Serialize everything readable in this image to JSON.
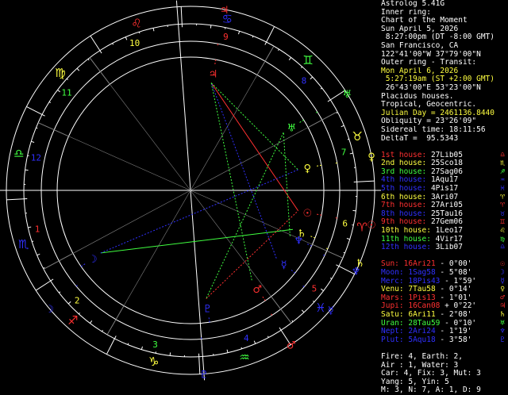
{
  "panel": {
    "title": "Astrolog 5.41G",
    "inner_ring_label": "Inner ring:",
    "inner_chart": "Chart of the Moment",
    "inner_date": "Sun April 5, 2026",
    "inner_time": " 8:27:00pm (DT -8:00 GMT)",
    "inner_place": "San Francisco, CA",
    "inner_coords": "122°41'00\"W 37°79'00\"N",
    "outer_ring_label": "Outer ring - Transit:",
    "outer_date": "Mon April 6, 2026",
    "outer_time": " 5:27:19am (ST +2:00 GMT)",
    "outer_coords": " 26°43'00\"E 53°23'00\"N",
    "houses_system": "Placidus houses.",
    "zodiac": "Tropical, Geocentric.",
    "julian_day": "Julian Day = 2461136.8440",
    "obliquity": "Obliquity = 23°26'09\"",
    "sidereal_time": "Sidereal time: 18:11:56",
    "delta_t": "DeltaT =  95.5343"
  },
  "houses": [
    {
      "label": "1st house:",
      "value": "27Lib05",
      "glyph": "♎",
      "color": "#ff3030"
    },
    {
      "label": "2nd house:",
      "value": "25Sco18",
      "glyph": "♏",
      "color": "#ffff40"
    },
    {
      "label": "3rd house:",
      "value": "27Sag06",
      "glyph": "♐",
      "color": "#40ff40"
    },
    {
      "label": "4th house:",
      "value": "1Aqu17",
      "glyph": "♒",
      "color": "#3030ff"
    },
    {
      "label": "5th house:",
      "value": "4Pis17",
      "glyph": "♓",
      "color": "#3030ff"
    },
    {
      "label": "6th house:",
      "value": "3Ari07",
      "glyph": "♈",
      "color": "#ffff40"
    },
    {
      "label": "7th house:",
      "value": "27Ari05",
      "glyph": "♈",
      "color": "#ff3030"
    },
    {
      "label": "8th house:",
      "value": "25Tau16",
      "glyph": "♉",
      "color": "#3030ff"
    },
    {
      "label": "9th house:",
      "value": "27Gem06",
      "glyph": "♊",
      "color": "#ff3030"
    },
    {
      "label": "10th house:",
      "value": "1Leo17",
      "glyph": "♌",
      "color": "#ffff40"
    },
    {
      "label": "11th house:",
      "value": "4Vir17",
      "glyph": "♍",
      "color": "#40ff40"
    },
    {
      "label": "12th house:",
      "value": "3Lib07",
      "glyph": "♎",
      "color": "#3030ff"
    }
  ],
  "planets": [
    {
      "label": "Sun:",
      "value": "16Ari21",
      "aspect": " - 0°00'",
      "glyph": "☉",
      "color": "#ff3030"
    },
    {
      "label": "Moon:",
      "value": "1Sag58",
      "aspect": " - 5°08'",
      "glyph": "☽",
      "color": "#3030ff"
    },
    {
      "label": "Merc:",
      "value": "18Pis43",
      "aspect": " - 1°59'",
      "glyph": "☿",
      "color": "#3030ff"
    },
    {
      "label": "Venu:",
      "value": "7Tau58",
      "aspect": " - 0°14'",
      "glyph": "♀",
      "color": "#ffff40"
    },
    {
      "label": "Mars:",
      "value": "1Pis13",
      "aspect": " - 1°01'",
      "glyph": "♂",
      "color": "#ff3030"
    },
    {
      "label": "Jupi:",
      "value": "16Can08",
      "aspect": " + 0°22'",
      "glyph": "♃",
      "color": "#ff3030"
    },
    {
      "label": "Satu:",
      "value": "6Ari11",
      "aspect": " - 2°08'",
      "glyph": "♄",
      "color": "#ffff40"
    },
    {
      "label": "Uran:",
      "value": "28Tau59",
      "aspect": " - 0°10'",
      "glyph": "♅",
      "color": "#40ff40"
    },
    {
      "label": "Nept:",
      "value": "2Ari24",
      "aspect": " - 1°19'",
      "glyph": "♆",
      "color": "#3030ff"
    },
    {
      "label": "Plut:",
      "value": "5Aqu18",
      "aspect": " - 3°58'",
      "glyph": "♇",
      "color": "#3030ff"
    }
  ],
  "summary": {
    "line1": "Fire: 4, Earth: 2,",
    "line2": "Air : 1, Water: 3",
    "line3": "Car: 4, Fix: 3, Mut: 3",
    "line4": "Yang: 5, Yin: 5",
    "line5": "M: 3, N: 7, A: 1, D: 9"
  },
  "colors": {
    "white": "#ffffff",
    "red": "#ff3030",
    "yellow": "#ffff40",
    "green": "#40ff40",
    "blue": "#3030ff",
    "gray": "#808080",
    "magenta": "#ff40ff"
  },
  "wheel": {
    "asc_longitude": 207.08,
    "cusps": [
      207.08,
      235.3,
      267.1,
      301.28,
      334.28,
      3.12,
      27.08,
      55.27,
      87.1,
      121.28,
      154.28,
      183.12
    ],
    "signs": [
      {
        "glyph": "♈",
        "color": "#ff3030"
      },
      {
        "glyph": "♉",
        "color": "#ffff40"
      },
      {
        "glyph": "♊",
        "color": "#40ff40"
      },
      {
        "glyph": "♋",
        "color": "#3030ff"
      },
      {
        "glyph": "♌",
        "color": "#ff3030"
      },
      {
        "glyph": "♍",
        "color": "#ffff40"
      },
      {
        "glyph": "♎",
        "color": "#40ff40"
      },
      {
        "glyph": "♏",
        "color": "#3030ff"
      },
      {
        "glyph": "♐",
        "color": "#ff3030"
      },
      {
        "glyph": "♑",
        "color": "#ffff40"
      },
      {
        "glyph": "♒",
        "color": "#40ff40"
      },
      {
        "glyph": "♓",
        "color": "#3030ff"
      }
    ],
    "house_numbers": [
      {
        "n": "1",
        "color": "#ff3030"
      },
      {
        "n": "2",
        "color": "#ffff40"
      },
      {
        "n": "3",
        "color": "#40ff40"
      },
      {
        "n": "4",
        "color": "#3030ff"
      },
      {
        "n": "5",
        "color": "#ff3030"
      },
      {
        "n": "6",
        "color": "#ffff40"
      },
      {
        "n": "7",
        "color": "#40ff40"
      },
      {
        "n": "8",
        "color": "#3030ff"
      },
      {
        "n": "9",
        "color": "#ff3030"
      },
      {
        "n": "10",
        "color": "#ffff40"
      },
      {
        "n": "11",
        "color": "#40ff40"
      },
      {
        "n": "12",
        "color": "#3030ff"
      }
    ],
    "inner_planets": [
      {
        "name": "sun",
        "glyph": "☉",
        "lon": 16.35,
        "color": "#ff3030"
      },
      {
        "name": "moon",
        "glyph": "☽",
        "lon": 241.97,
        "color": "#3030ff"
      },
      {
        "name": "mercury",
        "glyph": "☿",
        "lon": 348.72,
        "color": "#3030ff"
      },
      {
        "name": "venus",
        "glyph": "♀",
        "lon": 37.97,
        "color": "#ffff40"
      },
      {
        "name": "mars",
        "glyph": "♂",
        "lon": 331.22,
        "color": "#ff3030"
      },
      {
        "name": "jupiter",
        "glyph": "♃",
        "lon": 106.13,
        "color": "#ff3030"
      },
      {
        "name": "saturn",
        "glyph": "♄",
        "lon": 6.18,
        "color": "#ffff40"
      },
      {
        "name": "uranus",
        "glyph": "♅",
        "lon": 58.98,
        "color": "#40ff40"
      },
      {
        "name": "neptune",
        "glyph": "♆",
        "lon": 2.4,
        "color": "#3030ff"
      },
      {
        "name": "pluto",
        "glyph": "♇",
        "lon": 305.3,
        "color": "#3030ff"
      }
    ],
    "outer_planets": [
      {
        "name": "sun",
        "glyph": "☉",
        "lon": 16.35,
        "color": "#ff3030"
      },
      {
        "name": "moon",
        "glyph": "☽",
        "lon": 247.1,
        "color": "#3030ff"
      },
      {
        "name": "mercury",
        "glyph": "☿",
        "lon": 346.7,
        "color": "#3030ff"
      },
      {
        "name": "venus",
        "glyph": "♀",
        "lon": 37.7,
        "color": "#ffff40"
      },
      {
        "name": "mars",
        "glyph": "♂",
        "lon": 330.2,
        "color": "#ff3030"
      },
      {
        "name": "jupiter",
        "glyph": "♃",
        "lon": 106.5,
        "color": "#ff3030"
      },
      {
        "name": "saturn",
        "glyph": "♄",
        "lon": 4.0,
        "color": "#ffff40"
      },
      {
        "name": "uranus",
        "glyph": "♅",
        "lon": 58.8,
        "color": "#40ff40"
      },
      {
        "name": "neptune",
        "glyph": "♆",
        "lon": 1.1,
        "color": "#3030ff"
      },
      {
        "name": "pluto",
        "glyph": "♇",
        "lon": 301.3,
        "color": "#3030ff"
      }
    ],
    "aspects": [
      {
        "a": "sun",
        "b": "jupiter",
        "color": "#ff3030",
        "dash": "0"
      },
      {
        "a": "moon",
        "b": "saturn",
        "color": "#40ff40",
        "dash": "0"
      },
      {
        "a": "moon",
        "b": "venus",
        "color": "#3030ff",
        "dash": "2,2"
      },
      {
        "a": "jupiter",
        "b": "venus",
        "color": "#40ff40",
        "dash": "2,2"
      },
      {
        "a": "pluto",
        "b": "sun",
        "color": "#ff3030",
        "dash": "2,2"
      },
      {
        "a": "jupiter",
        "b": "mars",
        "color": "#40ff40",
        "dash": "2,2"
      },
      {
        "a": "uranus",
        "b": "pluto",
        "color": "#40ff40",
        "dash": "2,2"
      },
      {
        "a": "mercury",
        "b": "jupiter",
        "color": "#3030ff",
        "dash": "2,2"
      },
      {
        "a": "neptune",
        "b": "uranus",
        "color": "#40ff40",
        "dash": "2,2"
      }
    ]
  }
}
